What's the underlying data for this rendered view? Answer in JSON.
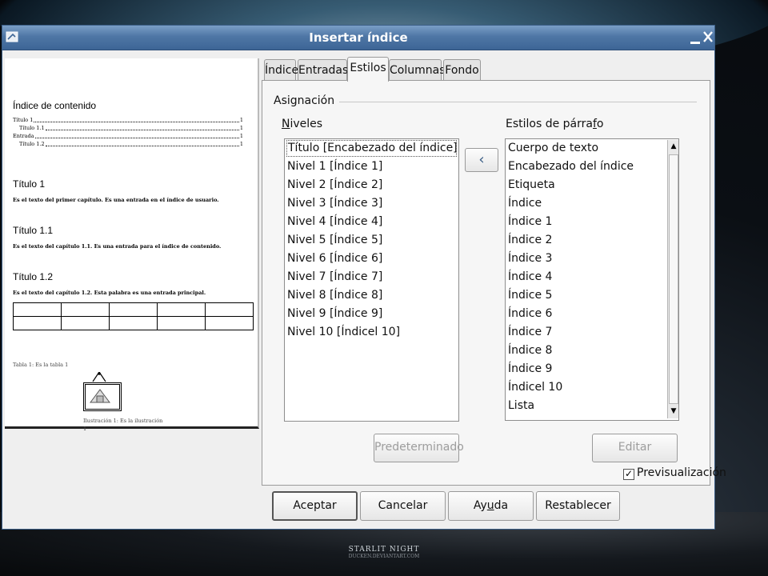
{
  "window": {
    "title": "Insertar índice"
  },
  "tabs": [
    {
      "label": "Índice",
      "active": false
    },
    {
      "label": "Entradas",
      "active": false
    },
    {
      "label": "Estilos",
      "active": true
    },
    {
      "label": "Columnas",
      "active": false
    },
    {
      "label": "Fondo",
      "active": false
    }
  ],
  "asignacion": {
    "label": "Asignación",
    "niveles_label_first": "N",
    "niveles_label_rest": "iveles",
    "estilos_label_first": "Estilos de párra",
    "estilos_label_u": "f",
    "estilos_label_rest": "o",
    "levels": [
      "Título [Encabezado del índice]",
      "Nivel 1 [Índice 1]",
      "Nivel 2 [Índice 2]",
      "Nivel 3 [Índice 3]",
      "Nivel 4 [Índice 4]",
      "Nivel 5 [Índice 5]",
      "Nivel 6 [Índice 6]",
      "Nivel 7 [Índice 7]",
      "Nivel 8 [Índice 8]",
      "Nivel 9 [Índice 9]",
      "Nivel 10 [Índicel 10]"
    ],
    "styles": [
      "Cuerpo de texto",
      "Encabezado del índice",
      "Etiqueta",
      "Índice",
      "Índice 1",
      "Índice 2",
      "Índice 3",
      "Índice 4",
      "Índice 5",
      "Índice 6",
      "Índice 7",
      "Índice 8",
      "Índice 9",
      "Índicel 10",
      "Lista"
    ],
    "assign_button": "‹",
    "predeterminado": "Predeterminado",
    "editar": "Editar"
  },
  "footer": {
    "aceptar": "Aceptar",
    "cancelar": "Cancelar",
    "ayuda_a": "Ay",
    "ayuda_u": "u",
    "ayuda_b": "da",
    "restablecer": "Restablecer",
    "preview_checkbox": "Previsualización",
    "preview_checked": "✓"
  },
  "preview": {
    "toc_title": "Índice de contenido",
    "toc": [
      {
        "label": "Título 1",
        "page": "1"
      },
      {
        "label": "Título 1.1",
        "page": "1"
      },
      {
        "label": "Entrada",
        "page": "1"
      },
      {
        "label": "Título 1.2",
        "page": "1"
      }
    ],
    "h1": "Título 1",
    "p1": "Es el texto del primer capítulo. Es una entrada en el índice de usuario.",
    "h2": "Título 1.1",
    "p2": "Es el texto del capítulo 1.1. Es una entrada para el índice de contenido.",
    "h3": "Título 1.2",
    "p3": "Es el texto del capítulo 1.2. Esta palabra es una entrada principal.",
    "table_caption": "Tabla 1: Es la tabla 1",
    "figure_caption": "Ilustración 1: Es la ilustración",
    "figure_caption_2": "1"
  },
  "wallpaper": {
    "line1": "STARLIT NIGHT",
    "line2": "DUCKEN.DEVIANTART.COM"
  }
}
